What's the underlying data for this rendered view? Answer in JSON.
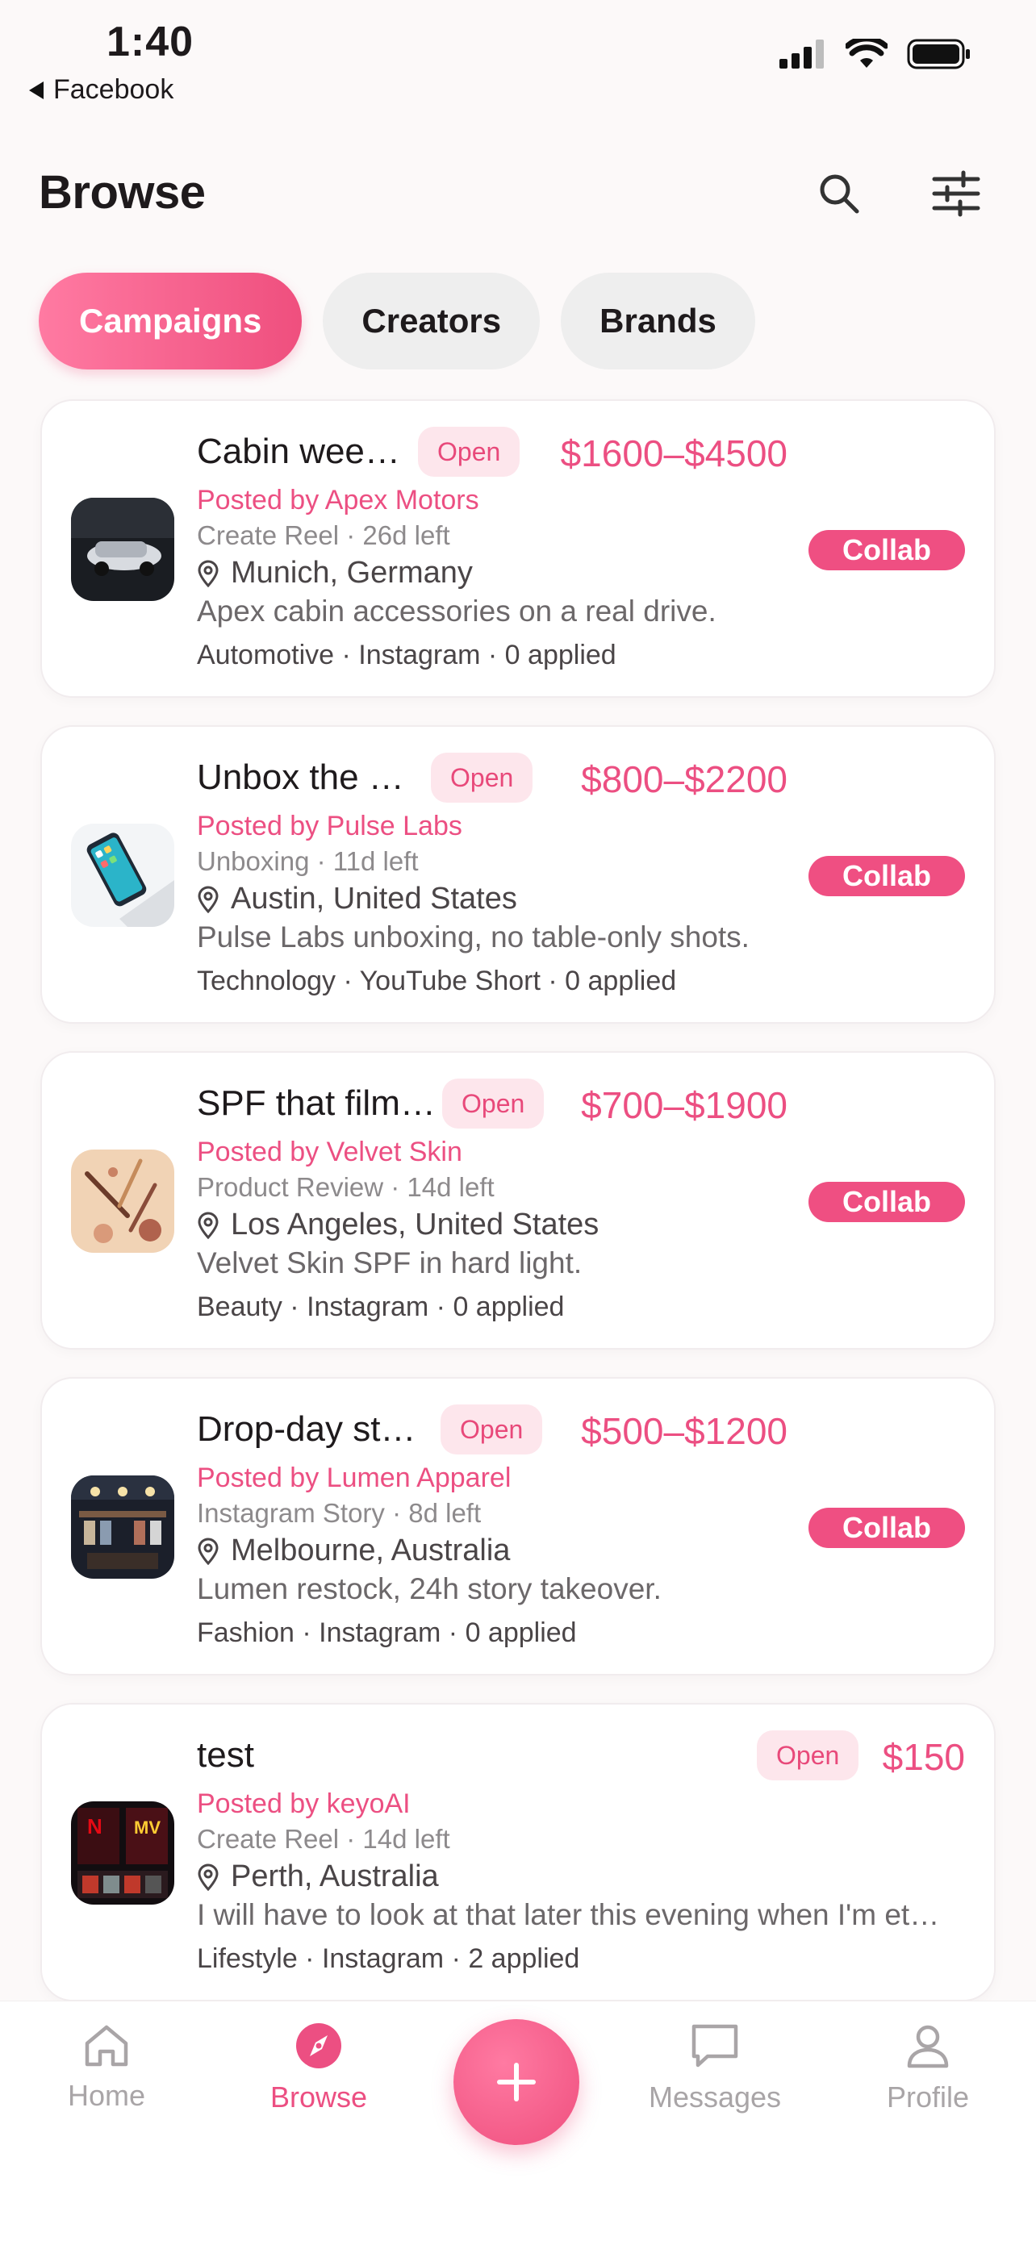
{
  "status_bar": {
    "time": "1:40",
    "back_app": "Facebook"
  },
  "header": {
    "title": "Browse"
  },
  "tabs": [
    {
      "label": "Campaigns",
      "active": true
    },
    {
      "label": "Creators",
      "active": false
    },
    {
      "label": "Brands",
      "active": false
    }
  ],
  "cards": [
    {
      "title": "Cabin wee…",
      "badge": "Open",
      "price": "$1600–$4500",
      "posted": "Posted by Apex Motors",
      "meta": "Create Reel · 26d left",
      "location": "Munich, Germany",
      "description": "Apex cabin accessories on a real drive.",
      "footer": "Automotive · Instagram  ·  0 applied",
      "action": "Collab"
    },
    {
      "title": "Unbox the …",
      "badge": "Open",
      "price": "$800–$2200",
      "posted": "Posted by Pulse Labs",
      "meta": "Unboxing · 11d left",
      "location": "Austin, United States",
      "description": "Pulse Labs unboxing, no table-only shots.",
      "footer": "Technology · YouTube Short  ·  0 applied",
      "action": "Collab"
    },
    {
      "title": "SPF that film…",
      "badge": "Open",
      "price": "$700–$1900",
      "posted": "Posted by Velvet Skin",
      "meta": "Product Review · 14d left",
      "location": "Los Angeles, United States",
      "description": "Velvet Skin SPF in hard light.",
      "footer": "Beauty · Instagram  ·  0 applied",
      "action": "Collab"
    },
    {
      "title": "Drop-day st…",
      "badge": "Open",
      "price": "$500–$1200",
      "posted": "Posted by Lumen Apparel",
      "meta": "Instagram Story · 8d left",
      "location": "Melbourne, Australia",
      "description": "Lumen restock, 24h story takeover.",
      "footer": "Fashion · Instagram  ·  0 applied",
      "action": "Collab"
    },
    {
      "title": "test",
      "badge": "Open",
      "price": "$150",
      "posted": "Posted by keyoAI",
      "meta": "Create Reel · 14d left",
      "location": "Perth, Australia",
      "description": "I will have to look at that later this evening when I'm et…",
      "footer": "Lifestyle · Instagram  ·  2 applied",
      "action": ""
    }
  ],
  "nav": {
    "home": "Home",
    "browse": "Browse",
    "messages": "Messages",
    "profile": "Profile"
  },
  "colors": {
    "accent": "#ec4f82",
    "badge_bg": "#fde6ec"
  }
}
